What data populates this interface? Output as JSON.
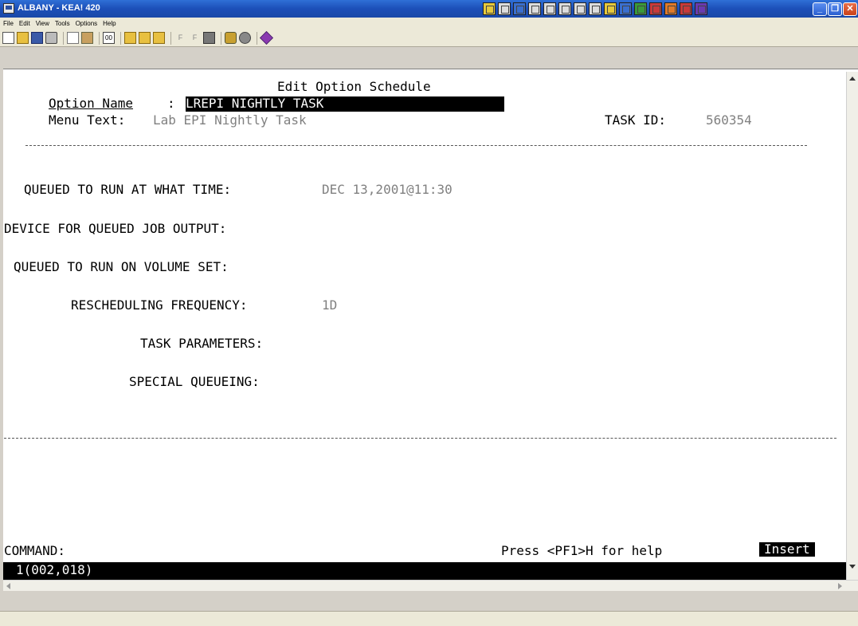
{
  "window": {
    "title": "ALBANY - KEA! 420",
    "controls": [
      "minimize",
      "maximize",
      "close"
    ]
  },
  "menu": [
    "File",
    "Edit",
    "View",
    "Tools",
    "Options",
    "Help"
  ],
  "toolbar_icons": [
    "new-icon",
    "open-icon",
    "save-icon",
    "print-icon",
    "copy-icon",
    "paste-icon",
    "connect-icon",
    "folder-icon",
    "folder-open-icon",
    "folder-up-icon",
    "f-key-icon",
    "f-key-alt-icon",
    "disk-icon",
    "lock-icon",
    "stop-icon",
    "gem-icon"
  ],
  "terminal": {
    "screen_title": "Edit Option Schedule",
    "option_name_label": "Option Name",
    "colon": ":",
    "option_name_value": "LREPI NIGHTLY TASK",
    "menu_text_label": "Menu Text:",
    "menu_text_value": "Lab EPI Nightly Task",
    "task_id_label": "TASK ID:",
    "task_id_value": "560354",
    "fields": [
      {
        "label": "QUEUED TO RUN AT WHAT TIME:",
        "value": "DEC 13,2001@11:30"
      },
      {
        "label": "DEVICE FOR QUEUED JOB OUTPUT:",
        "value": ""
      },
      {
        "label": "QUEUED TO RUN ON VOLUME SET:",
        "value": ""
      },
      {
        "label": "RESCHEDULING FREQUENCY:",
        "value": "1D"
      },
      {
        "label": "TASK PARAMETERS:",
        "value": ""
      },
      {
        "label": "SPECIAL QUEUEING:",
        "value": ""
      }
    ],
    "command_label": "COMMAND:",
    "help_hint": "Press <PF1>H for help",
    "mode": "Insert",
    "cursor_position": "1(002,018)"
  }
}
